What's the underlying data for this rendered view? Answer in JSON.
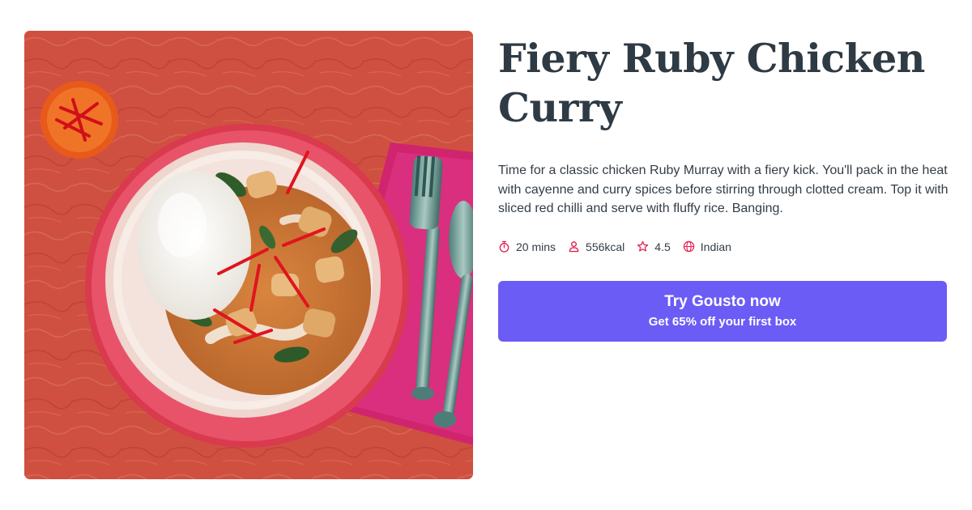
{
  "recipe": {
    "title": "Fiery Ruby Chicken Curry",
    "description": "Time for a classic chicken Ruby Murray with a fiery kick. You'll pack in the heat with cayenne and curry spices before stirring through clotted cream. Top it with sliced red chilli and serve with fluffy rice. Banging."
  },
  "meta": {
    "time": "20 mins",
    "calories": "556kcal",
    "rating": "4.5",
    "cuisine": "Indian",
    "icons": [
      "stopwatch-icon",
      "person-icon",
      "star-icon",
      "globe-icon"
    ]
  },
  "cta": {
    "title": "Try Gousto now",
    "subtitle": "Get 65% off your first box"
  },
  "colors": {
    "accent": "#6b5cf6",
    "icon": "#e0285a",
    "heading": "#2e3a44",
    "text": "#333d47",
    "photo_background": "#cf5040"
  }
}
